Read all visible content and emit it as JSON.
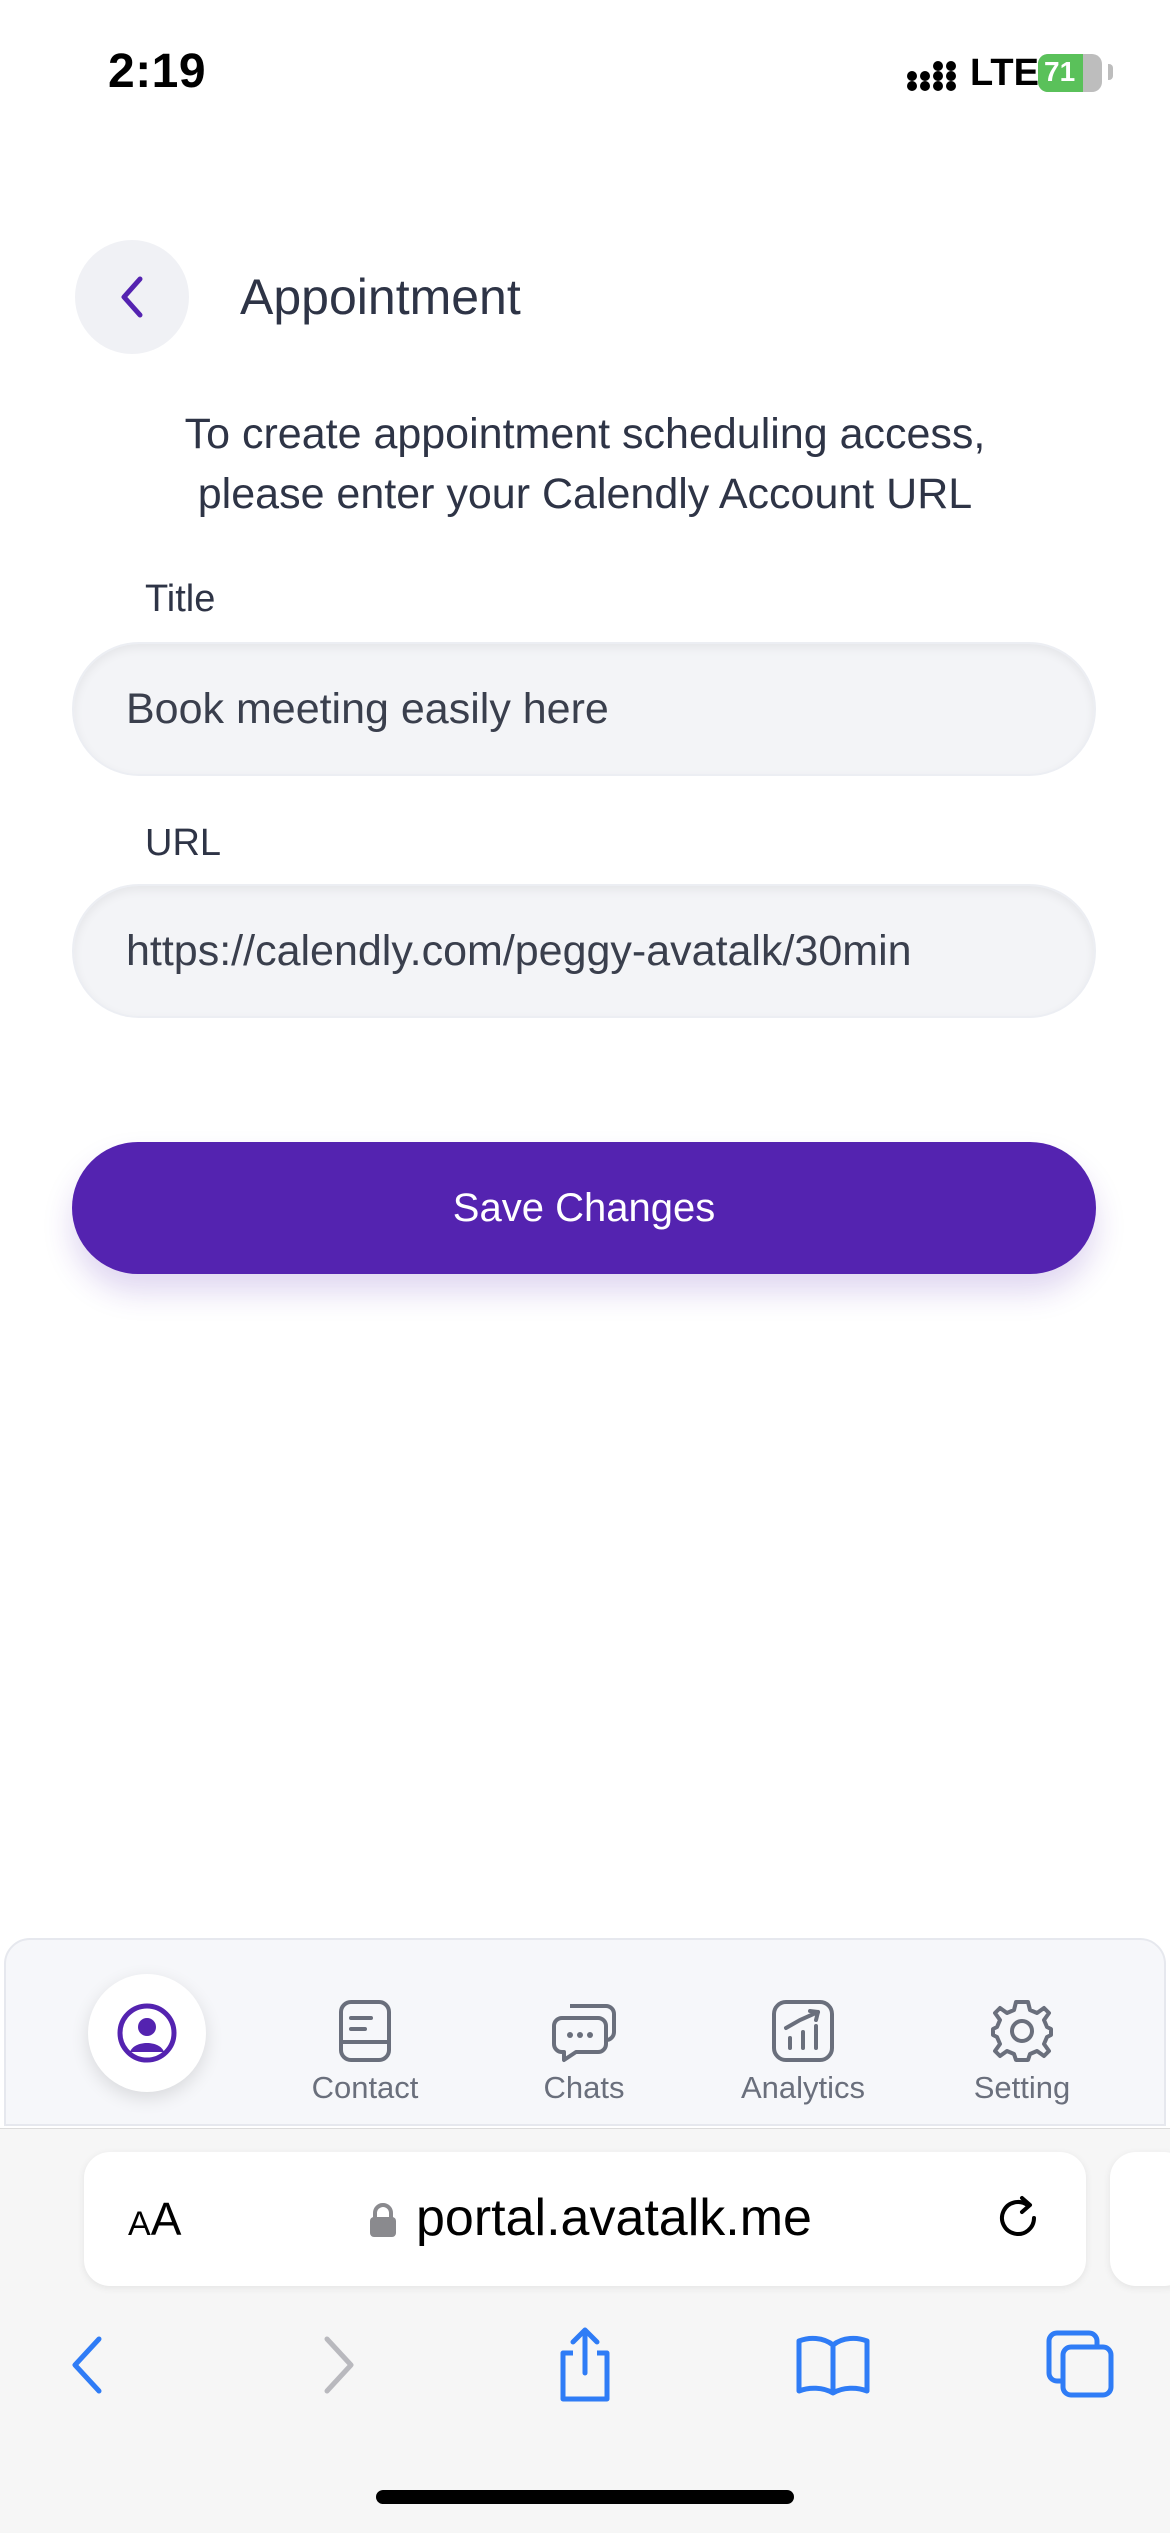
{
  "status_bar": {
    "time": "2:19",
    "network": "LTE",
    "battery": "71"
  },
  "header": {
    "title": "Appointment"
  },
  "intro": {
    "line1": "To create appointment scheduling access,",
    "line2": "please enter your Calendly Account URL"
  },
  "form": {
    "title_label": "Title",
    "title_value": "Book meeting easily here",
    "url_label": "URL",
    "url_value": "https://calendly.com/peggy-avatalk/30min"
  },
  "save_button": "Save Changes",
  "bottom_nav": {
    "items": [
      {
        "label": "Contact",
        "icon": "contact-book-icon"
      },
      {
        "label": "Chats",
        "icon": "chat-bubbles-icon"
      },
      {
        "label": "Analytics",
        "icon": "analytics-chart-icon"
      },
      {
        "label": "Setting",
        "icon": "gear-icon"
      }
    ],
    "active_icon": "profile-icon",
    "active_color": "#5423b0"
  },
  "browser": {
    "text_size_label_small": "A",
    "text_size_label_large": "A",
    "url": "portal.avatalk.me"
  },
  "colors": {
    "accent": "#5423b0",
    "safari_blue": "#2f7cf6"
  }
}
